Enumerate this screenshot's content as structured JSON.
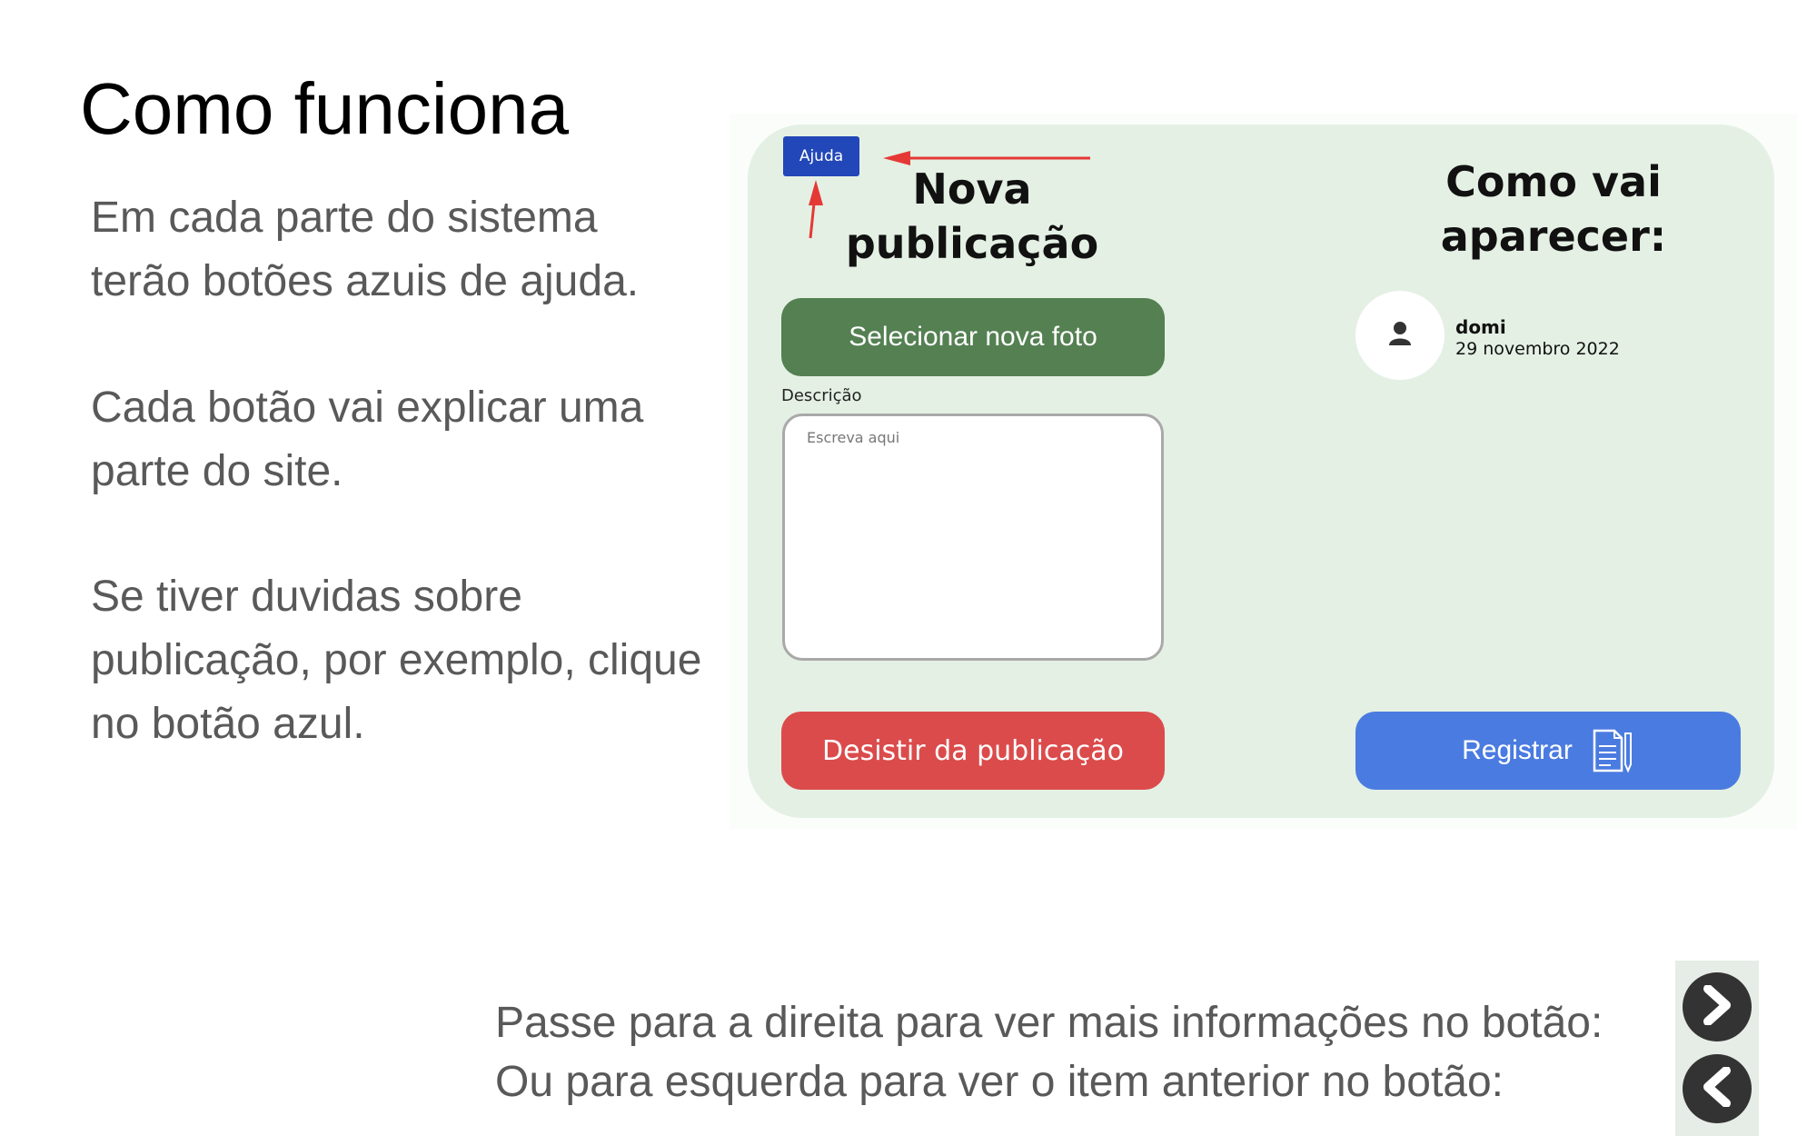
{
  "slide": {
    "title": "Como funciona",
    "paragraphs": [
      "Em cada parte do sistema terão botões azuis de ajuda.",
      "Cada botão vai explicar uma parte do site.",
      "Se tiver duvidas sobre publicação, por exemplo, clique no botão azul."
    ]
  },
  "mockup": {
    "help_label": "Ajuda",
    "form_heading": "Nova publicação",
    "preview_heading": "Como vai aparecer:",
    "select_photo_label": "Selecionar nova foto",
    "description_label": "Descrição",
    "description_placeholder": "Escreva aqui",
    "cancel_label": "Desistir da publicação",
    "register_label": "Registrar",
    "register_icon": "document-pencil-icon",
    "preview": {
      "username": "domi",
      "date": "29 novembro 2022",
      "avatar_icon": "user-icon"
    },
    "colors": {
      "card_bg": "#e4f0e4",
      "help": "#2247b8",
      "photo_button": "#548052",
      "cancel_button": "#db4b4b",
      "register_button": "#4a7be0",
      "annotation_arrow": "#e53935"
    }
  },
  "navigation": {
    "next_text": "Passe para a direita para ver mais informações no botão:",
    "prev_text": "Ou para esquerda para ver o item anterior no botão:",
    "next_icon": "chevron-right-icon",
    "prev_icon": "chevron-left-icon"
  }
}
